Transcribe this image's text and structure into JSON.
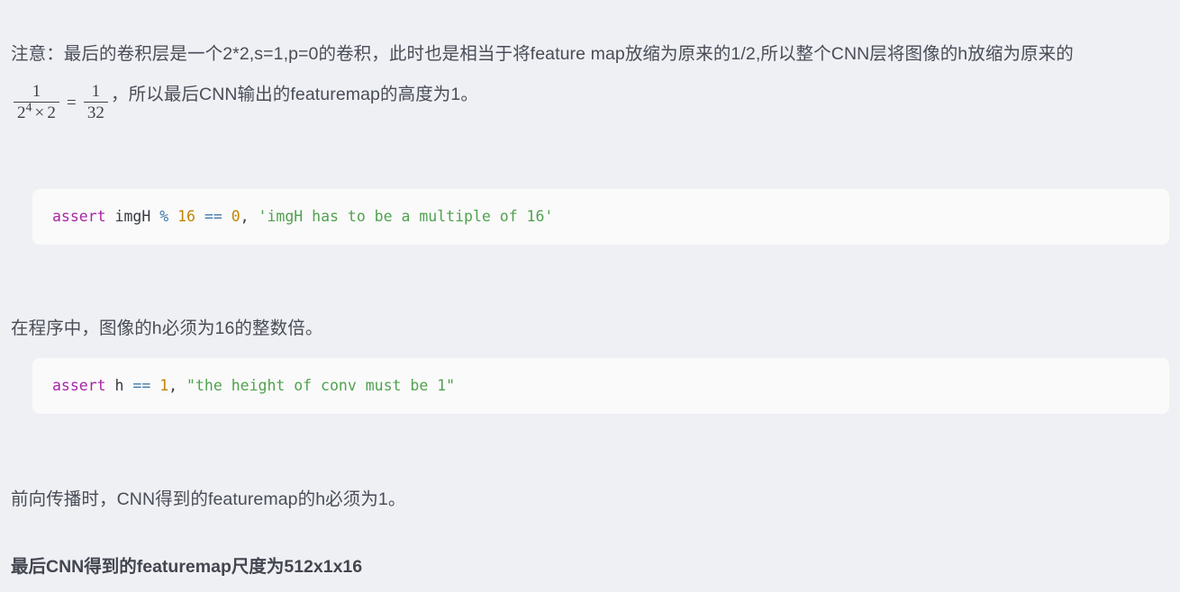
{
  "page": {
    "background_color": "#eef0f4",
    "text_color": "#4a4d57"
  },
  "paragraphs": {
    "intro": {
      "part_1": "注意：最后的卷积层是一个2*2,s=1,p=0的卷积，此时也是相当于将feature map放缩为原来的1/2,所以整个CNN层将图像的h放缩为原来的",
      "part_2": "，所以最后CNN输出的featuremap的高度为1。"
    },
    "middle": "在程序中，图像的h必须为16的整数倍。",
    "forward": "前向传播时，CNN得到的featuremap的h必须为1。",
    "bold_conclusion": "最后CNN得到的featuremap尺度为512x1x16"
  },
  "math": {
    "left_fraction": {
      "numerator": "1",
      "denominator_base": "2",
      "denominator_exponent": "4",
      "denominator_times": "×",
      "denominator_factor": "2"
    },
    "relation": "=",
    "right_fraction": {
      "numerator": "1",
      "denominator": "32"
    }
  },
  "code_blocks": [
    {
      "language": "python",
      "background_color": "#fafafa",
      "full_text": "assert imgH % 16 == 0, 'imgH has to be a multiple of 16'",
      "tokens": [
        {
          "text": "assert",
          "type": "keyword",
          "color": "#a626a4"
        },
        {
          "text": " ",
          "type": "space"
        },
        {
          "text": "imgH",
          "type": "identifier",
          "color": "#383a42"
        },
        {
          "text": " ",
          "type": "space"
        },
        {
          "text": "%",
          "type": "operator",
          "color": "#4078a8"
        },
        {
          "text": " ",
          "type": "space"
        },
        {
          "text": "16",
          "type": "number",
          "color": "#c18401"
        },
        {
          "text": " ",
          "type": "space"
        },
        {
          "text": "==",
          "type": "operator",
          "color": "#4078a8"
        },
        {
          "text": " ",
          "type": "space"
        },
        {
          "text": "0",
          "type": "number",
          "color": "#c18401"
        },
        {
          "text": ",",
          "type": "punctuation",
          "color": "#383a42"
        },
        {
          "text": " ",
          "type": "space"
        },
        {
          "text": "'imgH has to be a multiple of 16'",
          "type": "string",
          "color": "#50a14f"
        }
      ]
    },
    {
      "language": "python",
      "background_color": "#fafafa",
      "full_text": "assert h == 1, \"the height of conv must be 1\"",
      "tokens": [
        {
          "text": "assert",
          "type": "keyword",
          "color": "#a626a4"
        },
        {
          "text": " ",
          "type": "space"
        },
        {
          "text": "h",
          "type": "identifier",
          "color": "#383a42"
        },
        {
          "text": " ",
          "type": "space"
        },
        {
          "text": "==",
          "type": "operator",
          "color": "#4078a8"
        },
        {
          "text": " ",
          "type": "space"
        },
        {
          "text": "1",
          "type": "number",
          "color": "#c18401"
        },
        {
          "text": ",",
          "type": "punctuation",
          "color": "#383a42"
        },
        {
          "text": " ",
          "type": "space"
        },
        {
          "text": "\"the height of conv must be 1\"",
          "type": "string",
          "color": "#50a14f"
        }
      ]
    }
  ]
}
